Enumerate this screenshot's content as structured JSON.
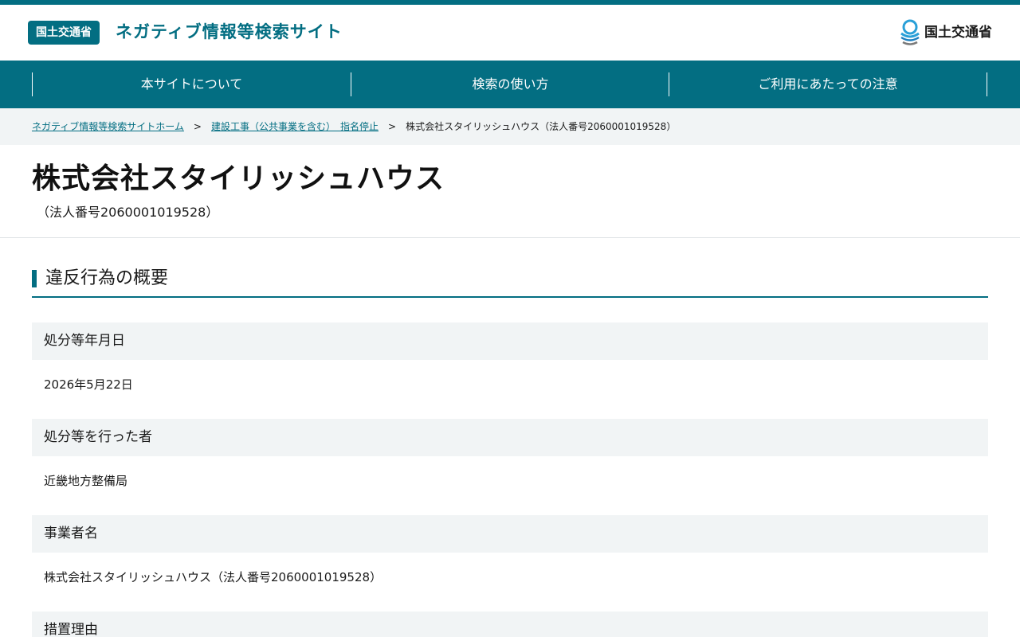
{
  "header": {
    "badge": "国土交通省",
    "site_title": "ネガティブ情報等検索サイト",
    "logo_text": "国土交通省"
  },
  "nav": {
    "items": [
      {
        "label": "本サイトについて"
      },
      {
        "label": "検索の使い方"
      },
      {
        "label": "ご利用にあたっての注意"
      }
    ]
  },
  "breadcrumb": {
    "home": "ネガティブ情報等検索サイトホーム",
    "category": "建設工事（公共事業を含む）　指名停止",
    "current": "株式会社スタイリッシュハウス（法人番号2060001019528）",
    "separator": ">"
  },
  "page": {
    "title": "株式会社スタイリッシュハウス",
    "subtitle": "（法人番号2060001019528）"
  },
  "section": {
    "heading": "違反行為の概要"
  },
  "details": [
    {
      "label": "処分等年月日",
      "value": "2026年5月22日"
    },
    {
      "label": "処分等を行った者",
      "value": "近畿地方整備局"
    },
    {
      "label": "事業者名",
      "value": "株式会社スタイリッシュハウス（法人番号2060001019528）"
    },
    {
      "label": "措置理由",
      "value": ""
    }
  ],
  "colors": {
    "brand": "#036e82",
    "row_bg": "#f1f4f5"
  }
}
